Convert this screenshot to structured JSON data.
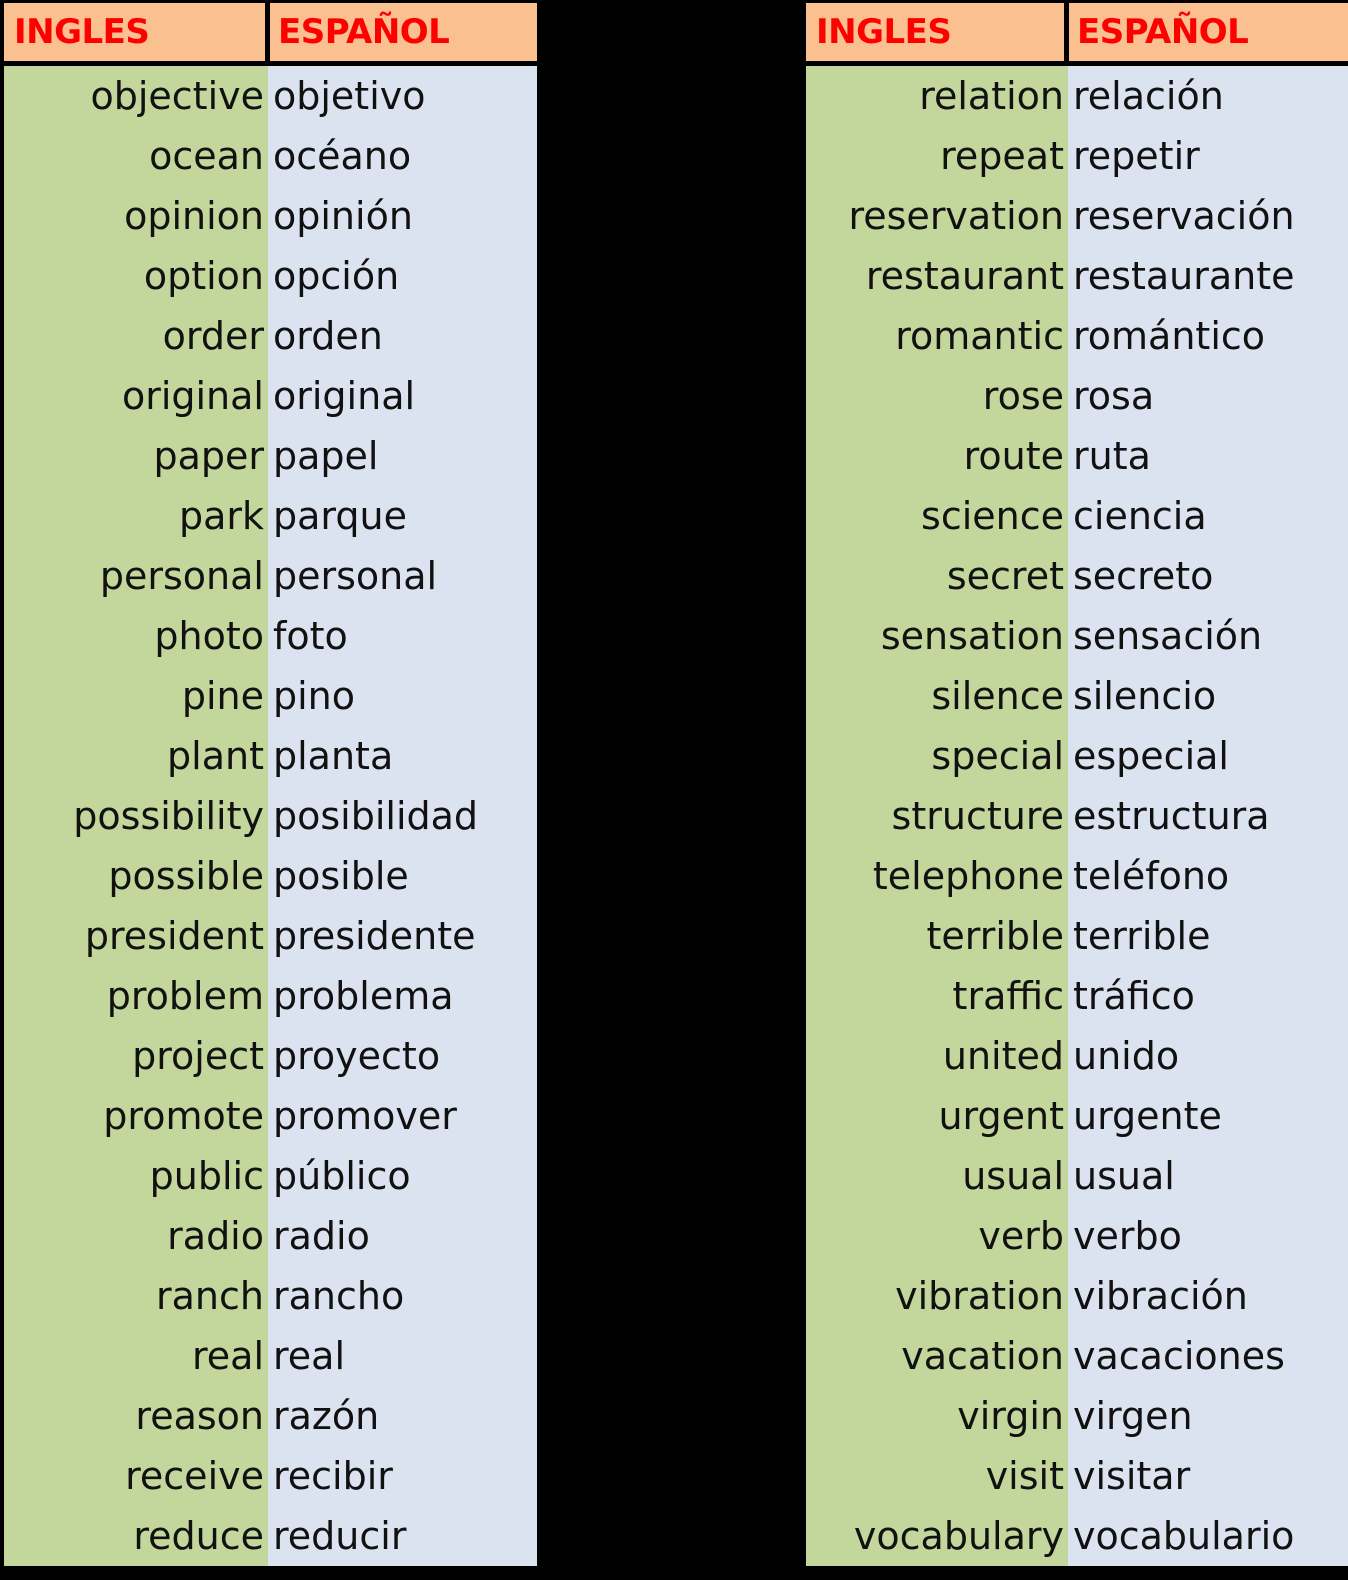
{
  "colors": {
    "background": "#000000",
    "header_fill": "#FAC090",
    "header_text": "#FF0000",
    "english_column_fill": "#C3D69B",
    "spanish_column_fill": "#DCE3F0",
    "body_text": "#111111"
  },
  "tables": [
    {
      "id": "left",
      "headers": {
        "english": "INGLES",
        "spanish": "ESPAÑOL"
      },
      "rows": [
        {
          "english": "objective",
          "spanish": "objetivo"
        },
        {
          "english": "ocean",
          "spanish": "océano"
        },
        {
          "english": "opinion",
          "spanish": "opinión"
        },
        {
          "english": "option",
          "spanish": "opción"
        },
        {
          "english": "order",
          "spanish": "orden"
        },
        {
          "english": "original",
          "spanish": "original"
        },
        {
          "english": "paper",
          "spanish": "papel"
        },
        {
          "english": "park",
          "spanish": "parque"
        },
        {
          "english": "personal",
          "spanish": "personal"
        },
        {
          "english": "photo",
          "spanish": "foto"
        },
        {
          "english": "pine",
          "spanish": "pino"
        },
        {
          "english": "plant",
          "spanish": "planta"
        },
        {
          "english": "possibility",
          "spanish": "posibilidad"
        },
        {
          "english": "possible",
          "spanish": "posible"
        },
        {
          "english": "president",
          "spanish": "presidente"
        },
        {
          "english": "problem",
          "spanish": "problema"
        },
        {
          "english": "project",
          "spanish": "proyecto"
        },
        {
          "english": "promote",
          "spanish": "promover"
        },
        {
          "english": "public",
          "spanish": "público"
        },
        {
          "english": "radio",
          "spanish": "radio"
        },
        {
          "english": "ranch",
          "spanish": "rancho"
        },
        {
          "english": "real",
          "spanish": "real"
        },
        {
          "english": "reason",
          "spanish": "razón"
        },
        {
          "english": "receive",
          "spanish": "recibir"
        },
        {
          "english": "reduce",
          "spanish": "reducir"
        }
      ]
    },
    {
      "id": "right",
      "headers": {
        "english": "INGLES",
        "spanish": "ESPAÑOL"
      },
      "rows": [
        {
          "english": "relation",
          "spanish": "relación"
        },
        {
          "english": "repeat",
          "spanish": "repetir"
        },
        {
          "english": "reservation",
          "spanish": "reservación"
        },
        {
          "english": "restaurant",
          "spanish": "restaurante"
        },
        {
          "english": "romantic",
          "spanish": "romántico"
        },
        {
          "english": "rose",
          "spanish": "rosa"
        },
        {
          "english": "route",
          "spanish": "ruta"
        },
        {
          "english": "science",
          "spanish": "ciencia"
        },
        {
          "english": "secret",
          "spanish": "secreto"
        },
        {
          "english": "sensation",
          "spanish": "sensación"
        },
        {
          "english": "silence",
          "spanish": "silencio"
        },
        {
          "english": "special",
          "spanish": "especial"
        },
        {
          "english": "structure",
          "spanish": "estructura"
        },
        {
          "english": "telephone",
          "spanish": "teléfono"
        },
        {
          "english": "terrible",
          "spanish": "terrible"
        },
        {
          "english": "traffic",
          "spanish": "tráfico"
        },
        {
          "english": "united",
          "spanish": "unido"
        },
        {
          "english": "urgent",
          "spanish": "urgente"
        },
        {
          "english": "usual",
          "spanish": "usual"
        },
        {
          "english": "verb",
          "spanish": "verbo"
        },
        {
          "english": "vibration",
          "spanish": "vibración"
        },
        {
          "english": "vacation",
          "spanish": "vacaciones"
        },
        {
          "english": "virgin",
          "spanish": "virgen"
        },
        {
          "english": "visit",
          "spanish": "visitar"
        },
        {
          "english": "vocabulary",
          "spanish": "vocabulario"
        }
      ]
    }
  ]
}
